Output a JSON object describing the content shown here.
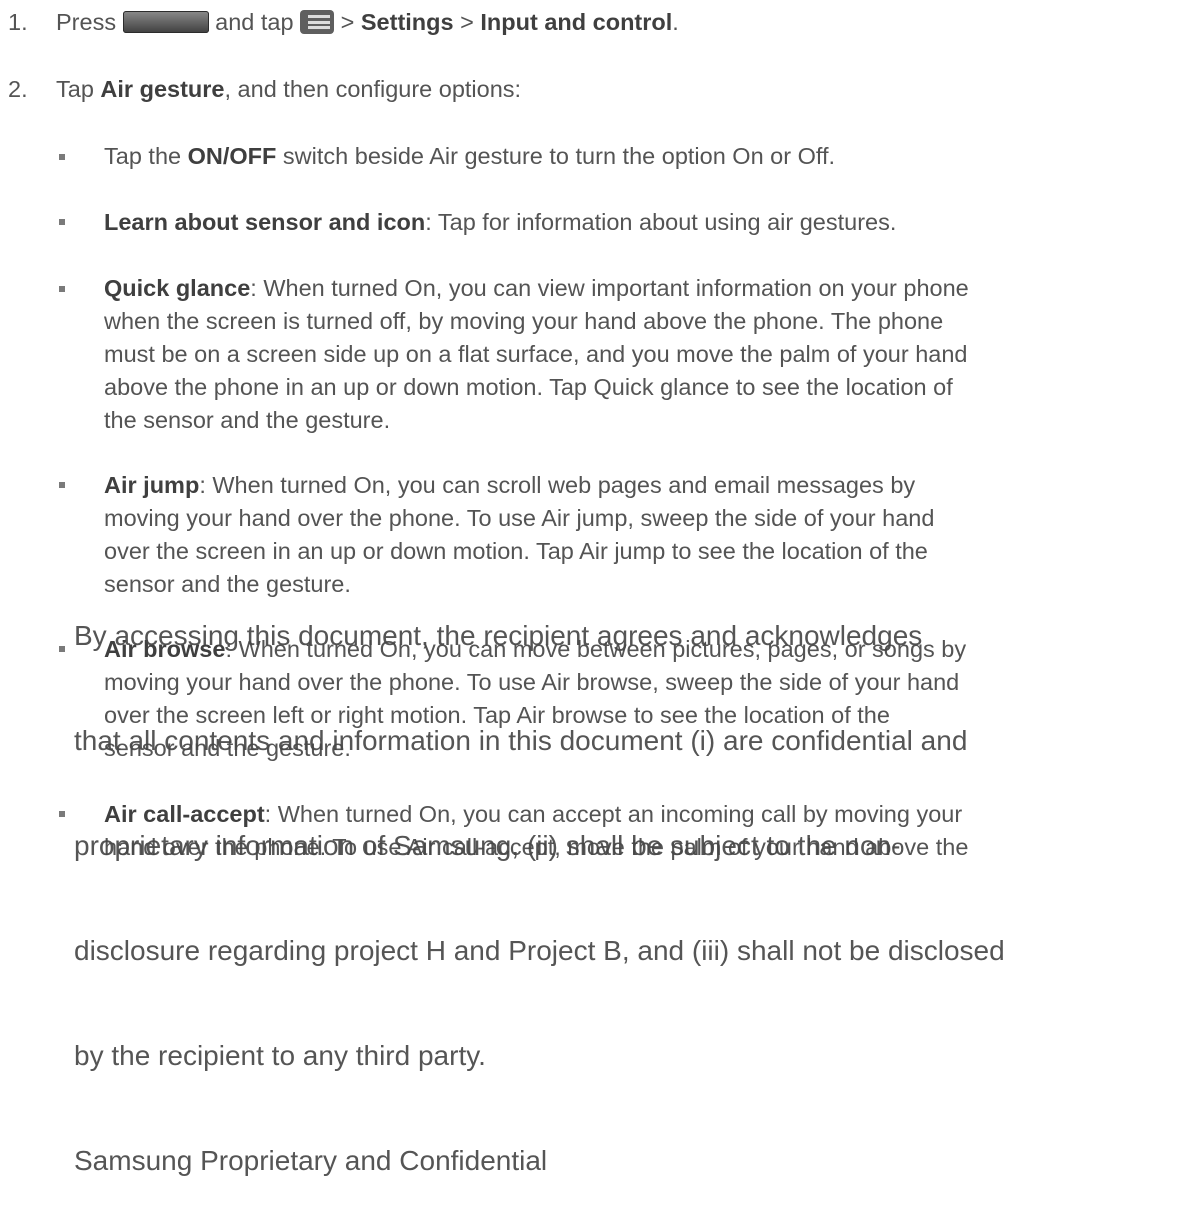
{
  "steps": [
    {
      "number": "1.",
      "t1": "Press",
      "home_icon": "home-key-icon",
      "t2": "and tap",
      "menu_icon": "menu-key-icon",
      "t3": " > ",
      "b1": "Settings",
      "t4": " > ",
      "b2": "Input and control",
      "t5": "."
    },
    {
      "number": "2.",
      "t1": "Tap ",
      "b1": "Air gesture",
      "t2": ", and then configure options:"
    }
  ],
  "options": [
    {
      "label": "ON/OFF",
      "pre": "Tap the ",
      "post": " switch beside Air gesture to turn the option On or Off."
    },
    {
      "label": "Learn about sensor and icon",
      "text": ": Tap for information about using air gestures."
    },
    {
      "label": "Quick glance",
      "lines": [
        ": When turned On, you can view important information on your phone",
        "when the screen is turned off, by moving your hand above the phone. The phone",
        "must be on a screen side up on a flat surface, and you move the palm of your hand",
        "above the phone in an up or down motion. Tap Quick glance to see the location of",
        "the sensor and the gesture."
      ]
    },
    {
      "label": "Air jump",
      "lines": [
        ": When turned On, you can scroll web pages and email messages by",
        "moving your hand over the phone. To use Air jump, sweep the side of your hand",
        "over the screen in an up or down motion. Tap Air jump to see the location of the",
        "sensor and the gesture."
      ]
    },
    {
      "label": "Air browse",
      "lines": [
        ": When turned On, you can move between pictures, pages, or songs by",
        "moving your hand over the phone. To use Air browse, sweep the side of your hand",
        "over the screen left or right motion. Tap Air browse to see the location of the",
        "sensor and the gesture."
      ]
    },
    {
      "label": "Air call-accept",
      "lines": [
        ": When turned On, you can accept an incoming call by moving your",
        "hand over the phone. To use Air call-accept, move the palm of your hand above the"
      ]
    }
  ],
  "watermark": {
    "lines": [
      "By accessing this document, the recipient agrees and acknowledges",
      "that all contents and information in this document (i) are confidential and",
      "proprietary information of Samsung, (ii) shall be subject to the non-",
      "disclosure regarding project H and Project B, and (iii) shall not be disclosed",
      "by the recipient to any third party.",
      "Samsung Proprietary and Confidential"
    ]
  }
}
